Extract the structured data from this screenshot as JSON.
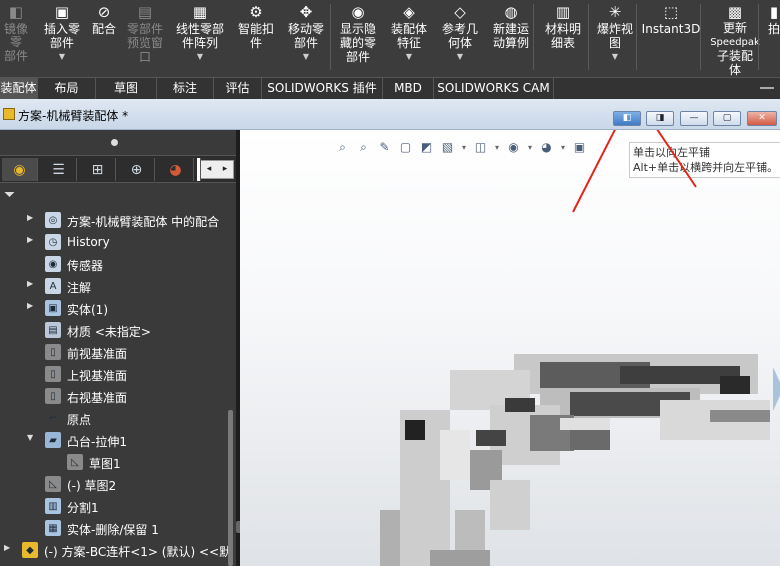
{
  "ribbon": {
    "buttons": [
      {
        "label1": "镜像零",
        "label2": "部件",
        "dim": true,
        "icon": "mirror-component-icon",
        "glyph": "◧"
      },
      {
        "label1": "插入零",
        "label2": "部件",
        "dim": false,
        "icon": "insert-component-icon",
        "glyph": "▣",
        "dropdown": "▼"
      },
      {
        "label1": "配合",
        "label2": "",
        "dim": false,
        "icon": "mate-icon",
        "glyph": "⊘"
      },
      {
        "label1": "零部件",
        "label2": "预览窗",
        "label3": "口",
        "dim": true,
        "icon": "component-preview-icon",
        "glyph": "▤"
      },
      {
        "label1": "线性零部",
        "label2": "件阵列",
        "dim": false,
        "icon": "linear-pattern-icon",
        "glyph": "▦",
        "dropdown": "▼"
      },
      {
        "label1": "智能扣",
        "label2": "件",
        "dim": false,
        "icon": "smart-fastener-icon",
        "glyph": "⚙"
      },
      {
        "label1": "移动零",
        "label2": "部件",
        "dim": false,
        "icon": "move-component-icon",
        "glyph": "✥",
        "dropdown": "▼"
      },
      {
        "label1": "显示隐",
        "label2": "藏的零",
        "label3": "部件",
        "dim": false,
        "icon": "show-hidden-icon",
        "glyph": "◉"
      },
      {
        "label1": "装配体",
        "label2": "特征",
        "dim": false,
        "icon": "assembly-feature-icon",
        "glyph": "◈",
        "dropdown": "▼"
      },
      {
        "label1": "参考几",
        "label2": "何体",
        "dim": false,
        "icon": "reference-geometry-icon",
        "glyph": "◇",
        "dropdown": "▼"
      },
      {
        "label1": "新建运",
        "label2": "动算例",
        "dim": false,
        "icon": "motion-study-icon",
        "glyph": "◍"
      },
      {
        "label1": "材料明",
        "label2": "细表",
        "dim": false,
        "icon": "bom-icon",
        "glyph": "▥"
      },
      {
        "label1": "爆炸视",
        "label2": "图",
        "dim": false,
        "icon": "exploded-view-icon",
        "glyph": "✳",
        "dropdown": "▼"
      },
      {
        "label1": "Instant3D",
        "label2": "",
        "dim": false,
        "icon": "instant3d-icon",
        "glyph": "⬚"
      },
      {
        "label1": "更新",
        "label2": "Speedpak",
        "label3": "子装配",
        "label4": "体",
        "dim": false,
        "icon": "speedpak-icon",
        "glyph": "▩"
      },
      {
        "label1": "拍",
        "label2": "",
        "dim": false,
        "icon": "snapshot-icon",
        "glyph": "▮"
      }
    ]
  },
  "tabs": [
    {
      "label": "装配体",
      "active": true
    },
    {
      "label": "布局",
      "active": false
    },
    {
      "label": "草图",
      "active": false
    },
    {
      "label": "标注",
      "active": false
    },
    {
      "label": "评估",
      "active": false
    },
    {
      "label": "SOLIDWORKS 插件",
      "active": false
    },
    {
      "label": "MBD",
      "active": false
    },
    {
      "label": "SOLIDWORKS CAM",
      "active": false
    }
  ],
  "document": {
    "title": "方案-机械臂装配体 *",
    "tile_left_glyph": "◧",
    "tile_right_glyph": "◨",
    "minimize_glyph": "—",
    "restore_glyph": "▢",
    "close_glyph": "✕"
  },
  "panel": {
    "tab_glyphs": [
      "◉",
      "☰",
      "⊞",
      "⊕",
      "◕"
    ],
    "scroll_left": "◂",
    "scroll_right": "▸",
    "filter_glyph": "▼",
    "tree": [
      {
        "label": "方案-机械臂装配体 中的配合",
        "icon": "mates-folder-icon",
        "arrow": "▶",
        "indent": 1,
        "glyph": "◎"
      },
      {
        "label": "History",
        "icon": "history-icon",
        "arrow": "▶",
        "indent": 1,
        "glyph": "◷"
      },
      {
        "label": "传感器",
        "icon": "sensor-icon",
        "arrow": "",
        "indent": 1,
        "glyph": "◉"
      },
      {
        "label": "注解",
        "icon": "annotation-icon",
        "arrow": "▶",
        "indent": 1,
        "glyph": "A"
      },
      {
        "label": "实体(1)",
        "icon": "solid-bodies-icon",
        "arrow": "▶",
        "indent": 1,
        "glyph": "▣"
      },
      {
        "label": "材质 <未指定>",
        "icon": "material-icon",
        "arrow": "",
        "indent": 1,
        "glyph": "▤"
      },
      {
        "label": "前视基准面",
        "icon": "plane-icon",
        "arrow": "",
        "indent": 1,
        "glyph": "▯"
      },
      {
        "label": "上视基准面",
        "icon": "plane-icon",
        "arrow": "",
        "indent": 1,
        "glyph": "▯"
      },
      {
        "label": "右视基准面",
        "icon": "plane-icon",
        "arrow": "",
        "indent": 1,
        "glyph": "▯"
      },
      {
        "label": "原点",
        "icon": "origin-icon",
        "arrow": "",
        "indent": 1,
        "glyph": "⌐"
      },
      {
        "label": "凸台-拉伸1",
        "icon": "extrude-icon",
        "arrow": "▼",
        "indent": 1,
        "glyph": "▰"
      },
      {
        "label": "草图1",
        "icon": "sketch-icon",
        "arrow": "",
        "indent": 2,
        "glyph": "◺"
      },
      {
        "label": "(-) 草图2",
        "icon": "sketch-icon",
        "arrow": "",
        "indent": 1,
        "glyph": "◺"
      },
      {
        "label": "分割1",
        "icon": "split-icon",
        "arrow": "",
        "indent": 1,
        "glyph": "▥"
      },
      {
        "label": "实体-删除/保留 1",
        "icon": "delete-body-icon",
        "arrow": "",
        "indent": 1,
        "glyph": "▦"
      },
      {
        "label": "(-) 方案-BC连杆<1> (默认) <<默",
        "icon": "part-icon",
        "arrow": "▶",
        "indent": 0,
        "glyph": "◆"
      }
    ]
  },
  "viewport": {
    "hud_glyphs": [
      "⌕",
      "⌕",
      "✎",
      "▢",
      "◩",
      "▧",
      "▾",
      "◫",
      "▾",
      "◉",
      "▾",
      "◕",
      "▾",
      "▣"
    ],
    "tooltip": {
      "line1": "单击以向左平铺",
      "line2": "Alt+单击以横跨并向左平铺。"
    }
  }
}
